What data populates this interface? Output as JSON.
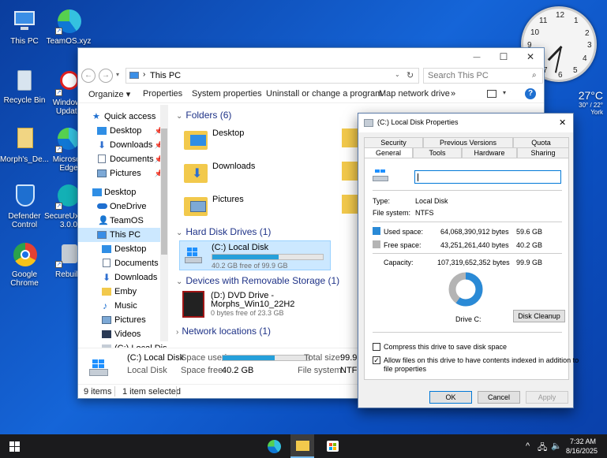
{
  "desktop_icons": [
    {
      "label": "This PC"
    },
    {
      "label": "TeamOS.xyz"
    },
    {
      "label": "Recycle Bin"
    },
    {
      "label": "Windows Update"
    },
    {
      "label": "Morph's_De..."
    },
    {
      "label": "Microsoft Edge"
    },
    {
      "label": "Defender Control"
    },
    {
      "label": "SecureUxTheme 3.0.0"
    },
    {
      "label": "Google Chrome"
    },
    {
      "label": "Rebuild"
    }
  ],
  "clock": {
    "numbers": [
      "12",
      "1",
      "2",
      "3",
      "4",
      "5",
      "6",
      "7",
      "8",
      "9",
      "10",
      "11"
    ]
  },
  "weather": {
    "temp": "27°C",
    "range": "30° / 22°",
    "city": "York"
  },
  "explorer": {
    "window_controls": {
      "minimize": "—",
      "maximize": "☐",
      "close": "✕"
    },
    "address": {
      "path": "This PC"
    },
    "search": {
      "placeholder": "Search This PC"
    },
    "toolbar": [
      "Organize ▾",
      "Properties",
      "System properties",
      "Uninstall or change a program",
      "Map network drive",
      "»"
    ],
    "nav": {
      "quick_access": "Quick access",
      "quick_items": [
        "Desktop",
        "Downloads",
        "Documents",
        "Pictures"
      ],
      "desktop": "Desktop",
      "onedrive": "OneDrive",
      "teamos": "TeamOS",
      "this_pc": "This PC",
      "pc_items": [
        "Desktop",
        "Documents",
        "Downloads",
        "Emby",
        "Music",
        "Pictures",
        "Videos",
        "(C:) Local Disk"
      ]
    },
    "sections": {
      "folders": "Folders (6)",
      "hard_disk": "Hard Disk Drives (1)",
      "removable": "Devices with Removable Storage (1)",
      "network": "Network locations (1)"
    },
    "folders": [
      "Desktop",
      "Downloads",
      "Pictures"
    ],
    "drive_c": {
      "name": "(C:) Local Disk",
      "free_text": "40.2 GB free of 99.9 GB",
      "used_fraction": 0.6
    },
    "drive_d": {
      "name_line1": "(D:) DVD Drive -",
      "name_line2": "Morphs_Win10_22H2",
      "free_text": "0 bytes free of 23.3 GB"
    },
    "details": {
      "name": "(C:) Local Disk",
      "type": "Local Disk",
      "space_used_label": "Space used:",
      "space_free_label": "Space free:",
      "space_free": "40.2 GB",
      "total_size_label": "Total size:",
      "total_size": "99.9",
      "file_system_label": "File system:",
      "file_system": "NTFS",
      "used_fraction": 0.6
    },
    "status": {
      "items": "9 items",
      "selected": "1 item selected"
    }
  },
  "dialog": {
    "title": "(C:) Local Disk Properties",
    "close": "✕",
    "tabs_top": [
      "Security",
      "Previous Versions",
      "Quota"
    ],
    "tabs_bottom": [
      "General",
      "Tools",
      "Hardware",
      "Sharing"
    ],
    "type_label": "Type:",
    "type_value": "Local Disk",
    "fs_label": "File system:",
    "fs_value": "NTFS",
    "used_label": "Used space:",
    "used_bytes": "64,068,390,912 bytes",
    "used_gb": "59.6 GB",
    "free_label": "Free space:",
    "free_bytes": "43,251,261,440 bytes",
    "free_gb": "40.2 GB",
    "cap_label": "Capacity:",
    "cap_bytes": "107,319,652,352 bytes",
    "cap_gb": "99.9 GB",
    "drive_label": "Drive C:",
    "cleanup": "Disk Cleanup",
    "compress": "Compress this drive to save disk space",
    "index_line1": "Allow files on this drive to have contents indexed in addition to",
    "index_line2": "file properties",
    "ok": "OK",
    "cancel": "Cancel",
    "apply": "Apply",
    "used_fraction": 0.597,
    "colors": {
      "used": "#2a8ad6",
      "free": "#b4b4b4"
    }
  },
  "taskbar": {
    "time": "7:32 AM",
    "date": "8/16/2025",
    "tray_chevron": "^"
  }
}
